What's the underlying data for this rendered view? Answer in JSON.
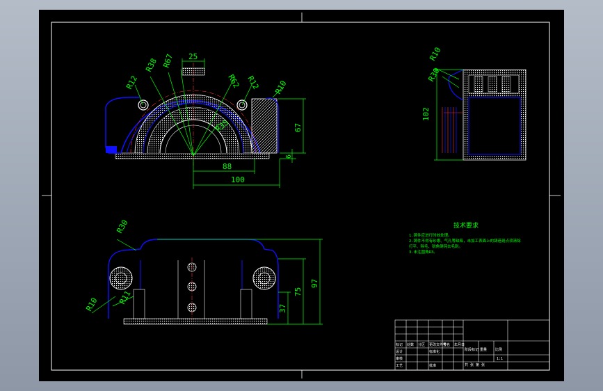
{
  "colors": {
    "frame": "#ffffff",
    "outline": "#1010ff",
    "dimension": "#00ff00",
    "center": "#ff3030",
    "hatch": "#ffffff",
    "notes": "#00ff00",
    "background": "#000000"
  },
  "front_view": {
    "dims": {
      "width_top": "25",
      "r38": "R38",
      "r67": "R67",
      "r62": "R62",
      "r12_left": "R12",
      "r12_right": "R12",
      "r10": "R10",
      "r35": "R35",
      "d88": "88",
      "d100": "100",
      "d67": "67",
      "d6": "6"
    }
  },
  "side_view": {
    "dims": {
      "r10": "R10",
      "r30": "R30",
      "d102": "102"
    }
  },
  "top_view": {
    "dims": {
      "r30": "R30",
      "r10": "R10",
      "r11": "R11",
      "d97": "97",
      "d75": "75",
      "d37": "37"
    }
  },
  "notes": {
    "title": "技术要求",
    "lines": [
      "1.铸件应进行时效处理。",
      "2.铸件不得有砂眼、气孔等缺陷，未加工表面上的铸造斑点须清除",
      "  打平、除毛、锐角倒钝去毛刺。",
      "3.未注圆角R3。"
    ]
  },
  "title_block": {
    "labels": [
      "标记",
      "处数",
      "分区",
      "更改文件号",
      "签名",
      "年月日",
      "设计",
      "标准化",
      "审核",
      "工艺",
      "批准",
      "阶段标记",
      "重量",
      "比例",
      "共 张 第 张"
    ],
    "scale": "1:1"
  }
}
